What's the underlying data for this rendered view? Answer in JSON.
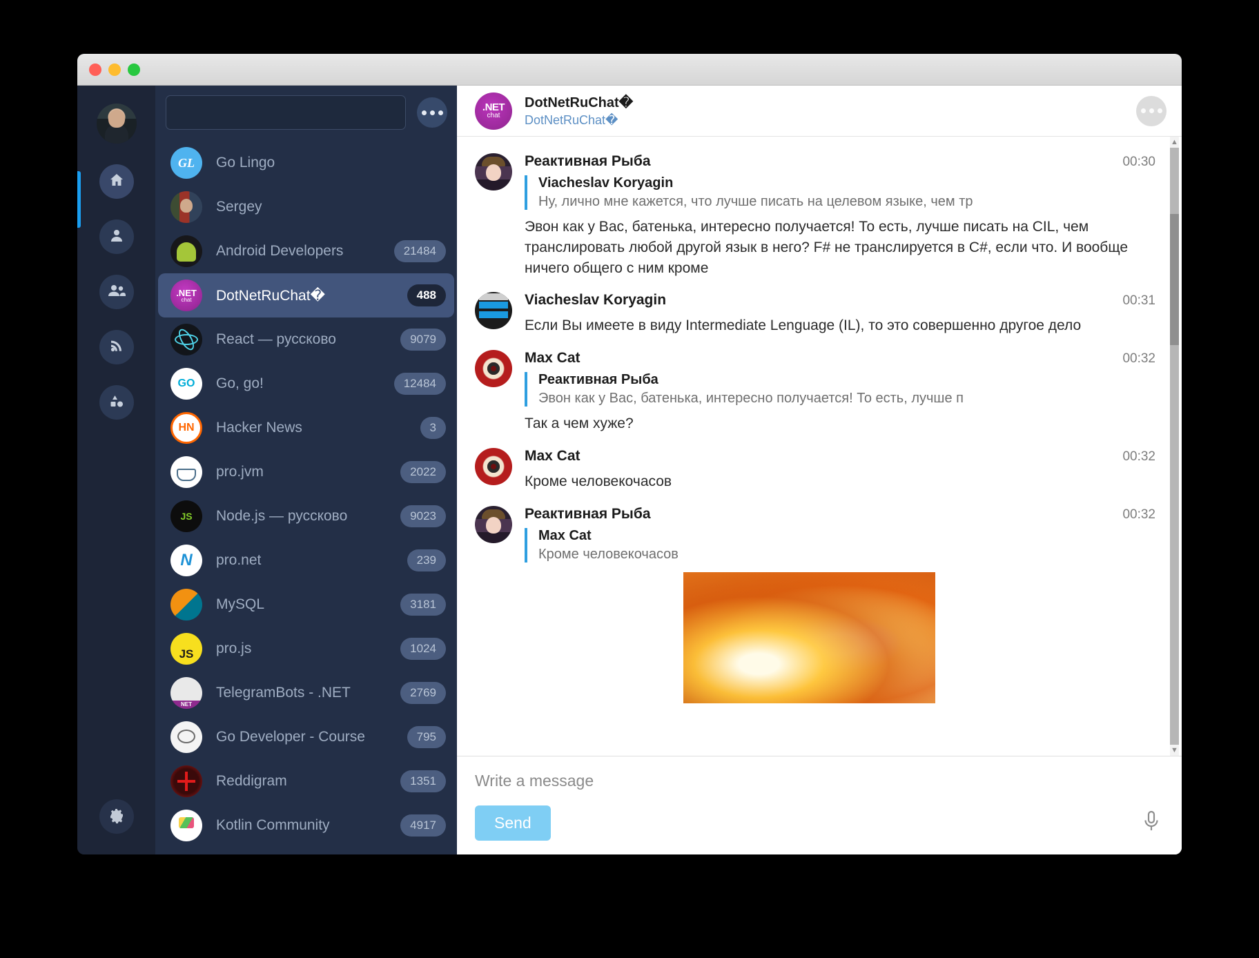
{
  "window": {
    "traffic_lights": [
      "close",
      "minimize",
      "maximize"
    ]
  },
  "rail": {
    "avatar_name": "user-avatar",
    "items": [
      {
        "icon": "home-icon",
        "label": "Home",
        "active": true
      },
      {
        "icon": "person-icon",
        "label": "Contacts",
        "active": false
      },
      {
        "icon": "people-icon",
        "label": "Groups",
        "active": false
      },
      {
        "icon": "rss-icon",
        "label": "Channels",
        "active": false
      },
      {
        "icon": "shapes-icon",
        "label": "Bots",
        "active": false
      }
    ],
    "settings": {
      "icon": "gear-icon",
      "label": "Settings"
    }
  },
  "sidebar": {
    "search": {
      "value": "",
      "placeholder": ""
    },
    "more_button_label": "More",
    "chats": [
      {
        "name": "Go Lingo",
        "badge": "",
        "avatar": "av-golingo",
        "initials": "",
        "selected": false
      },
      {
        "name": "Sergey",
        "badge": "",
        "avatar": "av-sergey",
        "initials": "",
        "selected": false
      },
      {
        "name": "Android Developers",
        "badge": "21484",
        "avatar": "av-android",
        "initials": "",
        "selected": false
      },
      {
        "name": "DotNetRuChat�",
        "badge": "488",
        "avatar": "av-dotnet",
        "initials": "",
        "selected": true
      },
      {
        "name": "React — руссково",
        "badge": "9079",
        "avatar": "av-react",
        "initials": "",
        "selected": false
      },
      {
        "name": "Go, go!",
        "badge": "12484",
        "avatar": "av-gogo",
        "initials": "",
        "selected": false
      },
      {
        "name": "Hacker News",
        "badge": "3",
        "avatar": "av-hn",
        "initials": "",
        "selected": false
      },
      {
        "name": "pro.jvm",
        "badge": "2022",
        "avatar": "av-jvm",
        "initials": "",
        "selected": false
      },
      {
        "name": "Node.js — руссково",
        "badge": "9023",
        "avatar": "av-node",
        "initials": "",
        "selected": false
      },
      {
        "name": "pro.net",
        "badge": "239",
        "avatar": "av-pronet",
        "initials": "",
        "selected": false
      },
      {
        "name": "MySQL",
        "badge": "3181",
        "avatar": "av-mysql",
        "initials": "",
        "selected": false
      },
      {
        "name": "pro.js",
        "badge": "1024",
        "avatar": "av-projs",
        "initials": "",
        "selected": false
      },
      {
        "name": "TelegramBots - .NET",
        "badge": "2769",
        "avatar": "av-tgbots",
        "initials": "",
        "selected": false
      },
      {
        "name": "Go Developer - Course",
        "badge": "795",
        "avatar": "av-godev",
        "initials": "",
        "selected": false
      },
      {
        "name": "Reddigram",
        "badge": "1351",
        "avatar": "av-reddigram",
        "initials": "",
        "selected": false
      },
      {
        "name": "Kotlin Community",
        "badge": "4917",
        "avatar": "av-kotlin",
        "initials": "",
        "selected": false
      }
    ]
  },
  "conversation": {
    "title": "DotNetRuChat�",
    "subtitle": "DotNetRuChat�",
    "avatar_net": ".NET",
    "avatar_chat": "chat",
    "more_button_label": "More",
    "messages": [
      {
        "author": "Реактивная Рыба",
        "time": "00:30",
        "avatar": "mav-fish",
        "quote_author": "Viacheslav Koryagin",
        "quote_text": "Ну, лично мне кажется, что лучше писать на целевом языке, чем тр",
        "text": "Эвон как у Вас, батенька, интересно получается! То есть, лучше писать на CIL, чем транслировать любой другой язык в него? F# не транслируется в C#, если что. И вообще ничего общего с ним кроме",
        "photo": false
      },
      {
        "author": "Viacheslav Koryagin",
        "time": "00:31",
        "avatar": "mav-privacy",
        "quote_author": "",
        "quote_text": "",
        "text": "Если Вы имеете в виду Intermediate Lenguage (IL), то это совершенно другое дело",
        "photo": false
      },
      {
        "author": "Max Cat",
        "time": "00:32",
        "avatar": "mav-maxcat",
        "quote_author": "Реактивная Рыба",
        "quote_text": "Эвон как у Вас, батенька, интересно получается! То есть, лучше п",
        "text": "Так а чем хуже?",
        "photo": false
      },
      {
        "author": "Max Cat",
        "time": "00:32",
        "avatar": "mav-maxcat",
        "quote_author": "",
        "quote_text": "",
        "text": "Кроме человекочасов",
        "photo": false
      },
      {
        "author": "Реактивная Рыба",
        "time": "00:32",
        "avatar": "mav-fish",
        "quote_author": "Max Cat",
        "quote_text": "Кроме человекочасов",
        "text": "",
        "photo": true
      }
    ]
  },
  "composer": {
    "input_value": "",
    "input_placeholder": "Write a message",
    "send_label": "Send",
    "mic_label": "Voice message"
  },
  "colors": {
    "accent_blue": "#1a9ef0",
    "sidebar_bg": "#232f47",
    "rail_bg": "#1d2537",
    "selected_row": "#42557c",
    "send_button": "#7fcef4",
    "quote_bar": "#2f9fe0"
  }
}
